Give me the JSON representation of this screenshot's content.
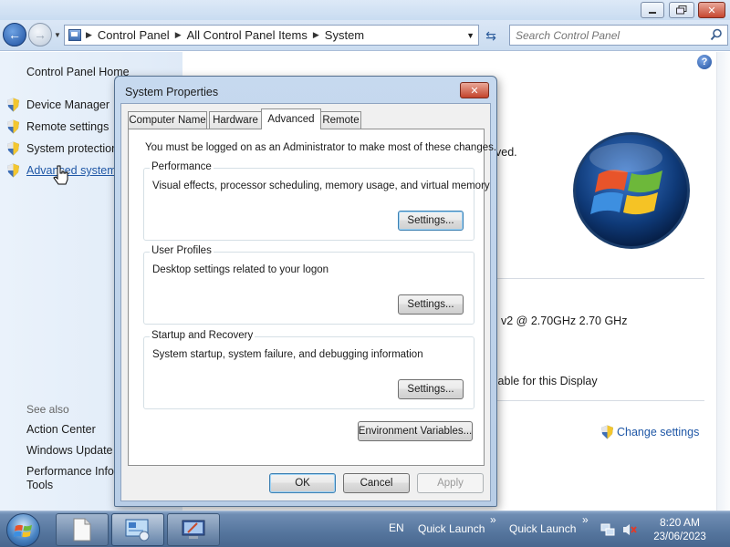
{
  "address": {
    "crumbs": [
      "Control Panel",
      "All Control Panel Items",
      "System"
    ]
  },
  "search": {
    "placeholder": "Search Control Panel"
  },
  "sidebar": {
    "home": "Control Panel Home",
    "tasks": [
      {
        "label": "Device Manager",
        "icon": "shield-icon"
      },
      {
        "label": "Remote settings",
        "icon": "shield-icon"
      },
      {
        "label": "System protection",
        "icon": "shield-icon"
      },
      {
        "label": "Advanced system",
        "icon": "shield-icon"
      }
    ],
    "see_also": "See also",
    "see_also_links": [
      "Action Center",
      "Windows Update",
      "Performance Infor",
      "Tools"
    ]
  },
  "main": {
    "fragments": [
      "ved.",
      "v2 @ 2.70GHz   2.70 GHz",
      "ilable for this Display"
    ],
    "change_settings": "Change settings"
  },
  "dialog": {
    "title": "System Properties",
    "close": "✕",
    "tabs": [
      "Computer Name",
      "Hardware",
      "Advanced",
      "Remote"
    ],
    "active_tab": "Advanced",
    "admin_note": "You must be logged on as an Administrator to make most of these changes.",
    "groups": [
      {
        "title": "Performance",
        "desc": "Visual effects, processor scheduling, memory usage, and virtual memory",
        "button": "Settings..."
      },
      {
        "title": "User Profiles",
        "desc": "Desktop settings related to your logon",
        "button": "Settings..."
      },
      {
        "title": "Startup and Recovery",
        "desc": "System startup, system failure, and debugging information",
        "button": "Settings..."
      }
    ],
    "env_button": "Environment Variables...",
    "ok": "OK",
    "cancel": "Cancel",
    "apply": "Apply"
  },
  "taskbar": {
    "lang": "EN",
    "quick_launch_1": "Quick Launch",
    "quick_launch_2": "Quick Launch",
    "chevron": "»",
    "time": "8:20 AM",
    "date": "23/06/2023"
  }
}
